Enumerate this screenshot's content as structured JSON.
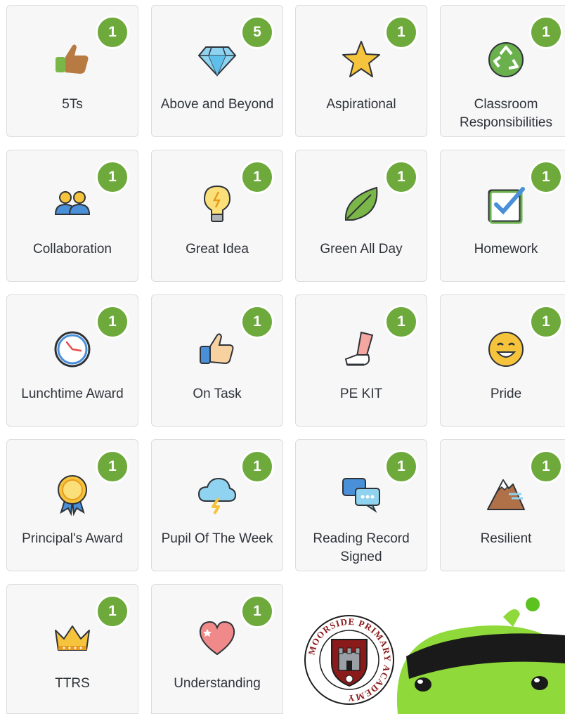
{
  "awards": [
    {
      "label": "5Ts",
      "count": "1",
      "icon": "thumbs-up-tan-icon"
    },
    {
      "label": "Above and Beyond",
      "count": "5",
      "icon": "diamond-icon"
    },
    {
      "label": "Aspirational",
      "count": "1",
      "icon": "star-icon"
    },
    {
      "label": "Classroom Responsibilities",
      "count": "1",
      "icon": "recycle-icon"
    },
    {
      "label": "Collaboration",
      "count": "1",
      "icon": "people-icon"
    },
    {
      "label": "Great Idea",
      "count": "1",
      "icon": "lightbulb-icon"
    },
    {
      "label": "Green All Day",
      "count": "1",
      "icon": "leaf-icon"
    },
    {
      "label": "Homework",
      "count": "1",
      "icon": "checkbox-icon"
    },
    {
      "label": "Lunchtime Award",
      "count": "1",
      "icon": "clock-icon"
    },
    {
      "label": "On Task",
      "count": "1",
      "icon": "thumbs-up-light-icon"
    },
    {
      "label": "PE KIT",
      "count": "1",
      "icon": "leg-sneaker-icon"
    },
    {
      "label": "Pride",
      "count": "1",
      "icon": "smile-face-icon"
    },
    {
      "label": "Principal's Award",
      "count": "1",
      "icon": "medal-rosette-icon"
    },
    {
      "label": "Pupil Of The Week",
      "count": "1",
      "icon": "cloud-lightning-icon"
    },
    {
      "label": "Reading Record Signed",
      "count": "1",
      "icon": "chat-bubbles-icon"
    },
    {
      "label": "Resilient",
      "count": "1",
      "icon": "mountain-icon"
    },
    {
      "label": "TTRS",
      "count": "1",
      "icon": "crown-icon"
    },
    {
      "label": "Understanding",
      "count": "1",
      "icon": "heart-icon"
    }
  ],
  "logo": {
    "text": "MOORSIDE PRIMARY ACADEMY"
  },
  "colors": {
    "badge": "#6ea93b",
    "card_bg": "#f7f7f8",
    "card_border": "#d9dce0",
    "text": "#2f3338"
  }
}
